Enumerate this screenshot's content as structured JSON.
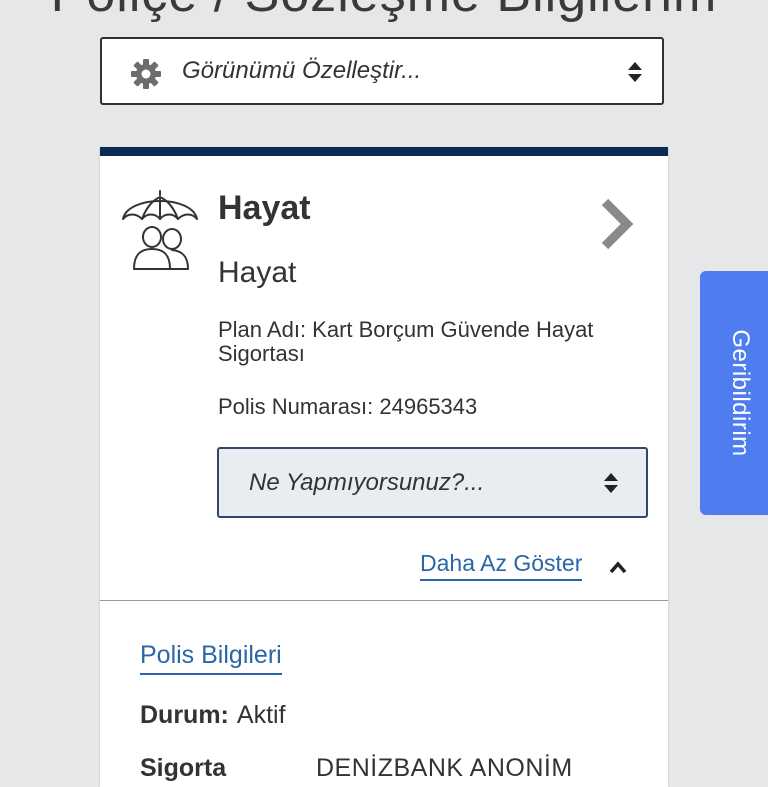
{
  "page": {
    "title": "Poliçe / Sözleşme Bilgilerim"
  },
  "view_customizer": {
    "label": "Görünümü Özelleştir...",
    "icon": "gear-icon"
  },
  "policy_card": {
    "accent_color": "#0d2a55",
    "icon": "umbrella-people-icon",
    "title": "Hayat",
    "subtitle": "Hayat",
    "plan_name": "Plan Adı: Kart Borçum Güvende Hayat Sigortası",
    "policy_number": "Polis Numarası: 24965343",
    "action_select": {
      "placeholder": "Ne Yapmıyorsunuz?..."
    },
    "show_less": "Daha Az Göster",
    "details": {
      "section_title": "Polis Bilgileri",
      "status_label": "Durum:",
      "status_value": "Aktif",
      "insurer_label": "Sigorta",
      "insurer_value": "DENİZBANK ANONİM"
    }
  },
  "feedback": {
    "label": "Geribildirim",
    "color": "#4f7df0"
  }
}
